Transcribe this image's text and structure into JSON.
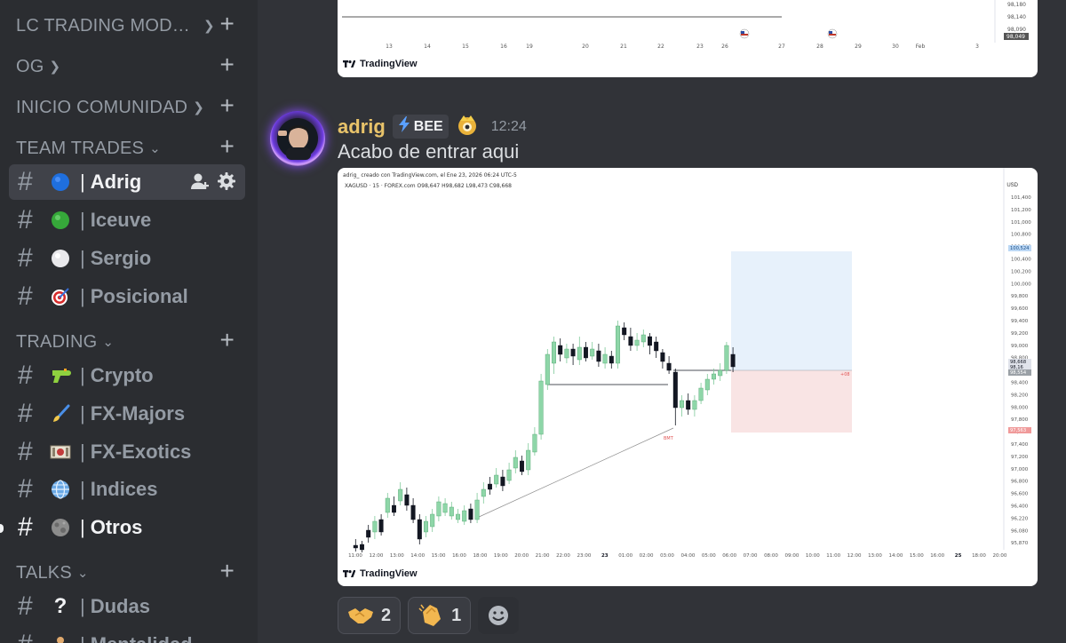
{
  "sidebar": {
    "categories": [
      {
        "label": "LC TRADING MODEL ...",
        "chevron": "right"
      },
      {
        "label": "OG",
        "chevron": "right"
      },
      {
        "label": "INICIO COMUNIDAD",
        "chevron": "right"
      },
      {
        "label": "TEAM TRADES",
        "chevron": "down"
      },
      {
        "label": "TRADING",
        "chevron": "down"
      },
      {
        "label": "TALKS",
        "chevron": "down"
      }
    ],
    "channels": [
      {
        "emoji": "blue-circle",
        "separator": "|",
        "name": "Adrig",
        "active": true
      },
      {
        "emoji": "green-circle",
        "separator": "|",
        "name": "Iceuve"
      },
      {
        "emoji": "white-circle",
        "separator": "|",
        "name": "Sergio"
      },
      {
        "emoji": "dart-target",
        "separator": "|",
        "name": "Posicional"
      },
      {
        "emoji": "water-pistol",
        "separator": "|",
        "name": "Crypto"
      },
      {
        "emoji": "paintbrush",
        "separator": "|",
        "name": "FX-Majors"
      },
      {
        "emoji": "money-bill",
        "separator": "|",
        "name": "FX-Exotics"
      },
      {
        "emoji": "globe",
        "separator": "|",
        "name": "Indices"
      },
      {
        "emoji": "moon",
        "separator": "|",
        "name": "Otros",
        "unread": true
      },
      {
        "emoji": "question-mark",
        "separator": "|",
        "name": "Dudas"
      },
      {
        "emoji": "person",
        "separator": "|",
        "name": "Mentalidad"
      }
    ]
  },
  "message": {
    "author": "adrig",
    "badge": "BEE",
    "time": "12:24",
    "text": "Acabo de entrar aqui",
    "author_color": "#e8c36a"
  },
  "top_embed": {
    "x_labels": [
      "13",
      "14",
      "15",
      "16",
      "19",
      "20",
      "21",
      "22",
      "23",
      "26",
      "27",
      "28",
      "29",
      "30",
      "Feb",
      "3"
    ],
    "y_labels": [
      "98,180",
      "98,140",
      "98,090"
    ],
    "price_tag": "98,049",
    "watermark": "TradingView"
  },
  "chart_embed": {
    "meta": "adrig_ creado con TradingView.com, el Ene 23, 2026 06:24 UTC-5",
    "ohlc": "XAGUSD · 15 · FOREX.com  O98,647  H98,682  L98,473  C98,668",
    "currency": "USD",
    "watermark": "TradingView",
    "y_ticks": [
      "101,400",
      "101,200",
      "101,000",
      "100,800",
      "100,600",
      "100,400",
      "100,200",
      "100,000",
      "99,800",
      "99,600",
      "99,400",
      "99,200",
      "99,000",
      "98,800",
      "98,600",
      "98,400",
      "98,200",
      "98,000",
      "97,800",
      "97,600",
      "97,400",
      "97,200",
      "97,000",
      "96,800",
      "96,600",
      "96,400",
      "96,220",
      "96,080",
      "95,870"
    ],
    "x_ticks": [
      "11:00",
      "12:00",
      "13:00",
      "14:00",
      "15:00",
      "16:00",
      "18:00",
      "19:00",
      "20:00",
      "21:00",
      "22:00",
      "23:00",
      "23",
      "01:00",
      "02:00",
      "03:00",
      "04:00",
      "05:00",
      "06:00",
      "07:00",
      "08:00",
      "09:00",
      "10:00",
      "11:00",
      "12:00",
      "13:00",
      "14:00",
      "15:00",
      "16:00",
      "25",
      "18:00",
      "20:00"
    ],
    "price_tags": {
      "target": "100,524",
      "current": "98,668",
      "current2": "98,16",
      "entry": "98,554",
      "stop": "97,563"
    },
    "annotation_entry": "+08",
    "annotation_line": "BMT"
  },
  "reactions": [
    {
      "emoji": "handshake",
      "count": "2"
    },
    {
      "emoji": "clapping-hands",
      "count": "1"
    }
  ]
}
